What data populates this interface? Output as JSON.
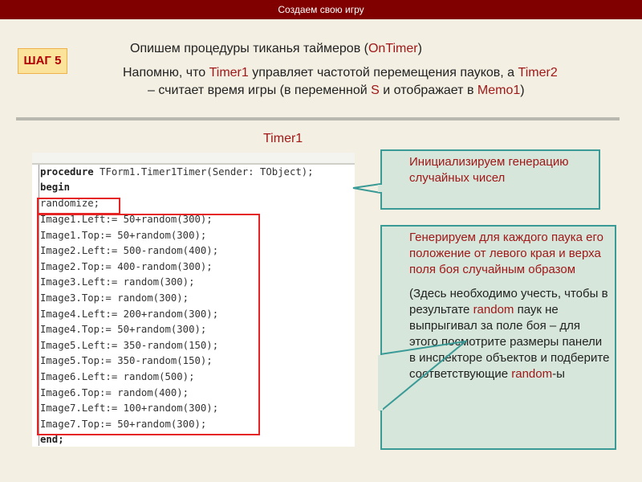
{
  "header": {
    "title": "Создаем свою игру"
  },
  "step": {
    "label": "ШАГ 5"
  },
  "intro": {
    "line1": {
      "a": "Опишем процедуры тиканья таймеров (",
      "b": "OnTimer",
      "c": ")"
    },
    "line2": {
      "a": "Напомню, что ",
      "b": "Timer1",
      "c": "  управляет частотой перемещения пауков, а ",
      "d": "Timer2"
    },
    "line3": {
      "a": "– считает время игры (в переменной ",
      "b": "S",
      "c": " и отображает в ",
      "d": "Memo1",
      "e": ")"
    }
  },
  "section_title": "Timer1",
  "code": {
    "header_kw": "procedure",
    "header_rest": " TForm1.Timer1Timer(Sender: TObject);",
    "begin": "begin",
    "randomize": "randomize;",
    "lines": [
      "Image1.Left:= 50+random(300);",
      "Image1.Top:= 50+random(300);",
      "Image2.Left:= 500-random(400);",
      "Image2.Top:= 400-random(300);",
      "Image3.Left:= random(300);",
      "Image3.Top:= random(300);",
      "Image4.Left:= 200+random(300);",
      "Image4.Top:= 50+random(300);",
      "Image5.Left:= 350-random(150);",
      "Image5.Top:= 350-random(150);",
      "Image6.Left:= random(500);",
      "Image6.Top:= random(400);",
      "Image7.Left:= 100+random(300);",
      "Image7.Top:= 50+random(300);"
    ],
    "end": "end;"
  },
  "callout1": {
    "text": "Инициализируем генерацию случайных чисел"
  },
  "callout2": {
    "text": "Генерируем для каждого паука его положение от левого края и верха поля боя случайным образом",
    "note_a": "(Здесь необходимо учесть, чтобы в результате ",
    "note_b": "random",
    "note_c": " паук не выпрыгивал за поле боя – для этого посмотрите размеры панели в инспекторе объектов и подберите соответствующие ",
    "note_d": "random",
    "note_e": "-ы"
  },
  "colors": {
    "header": "#800000",
    "accent": "#a01818",
    "callout_bg": "#d7e6db",
    "callout_border": "#3a9a96",
    "highlight_box": "#e52525"
  }
}
